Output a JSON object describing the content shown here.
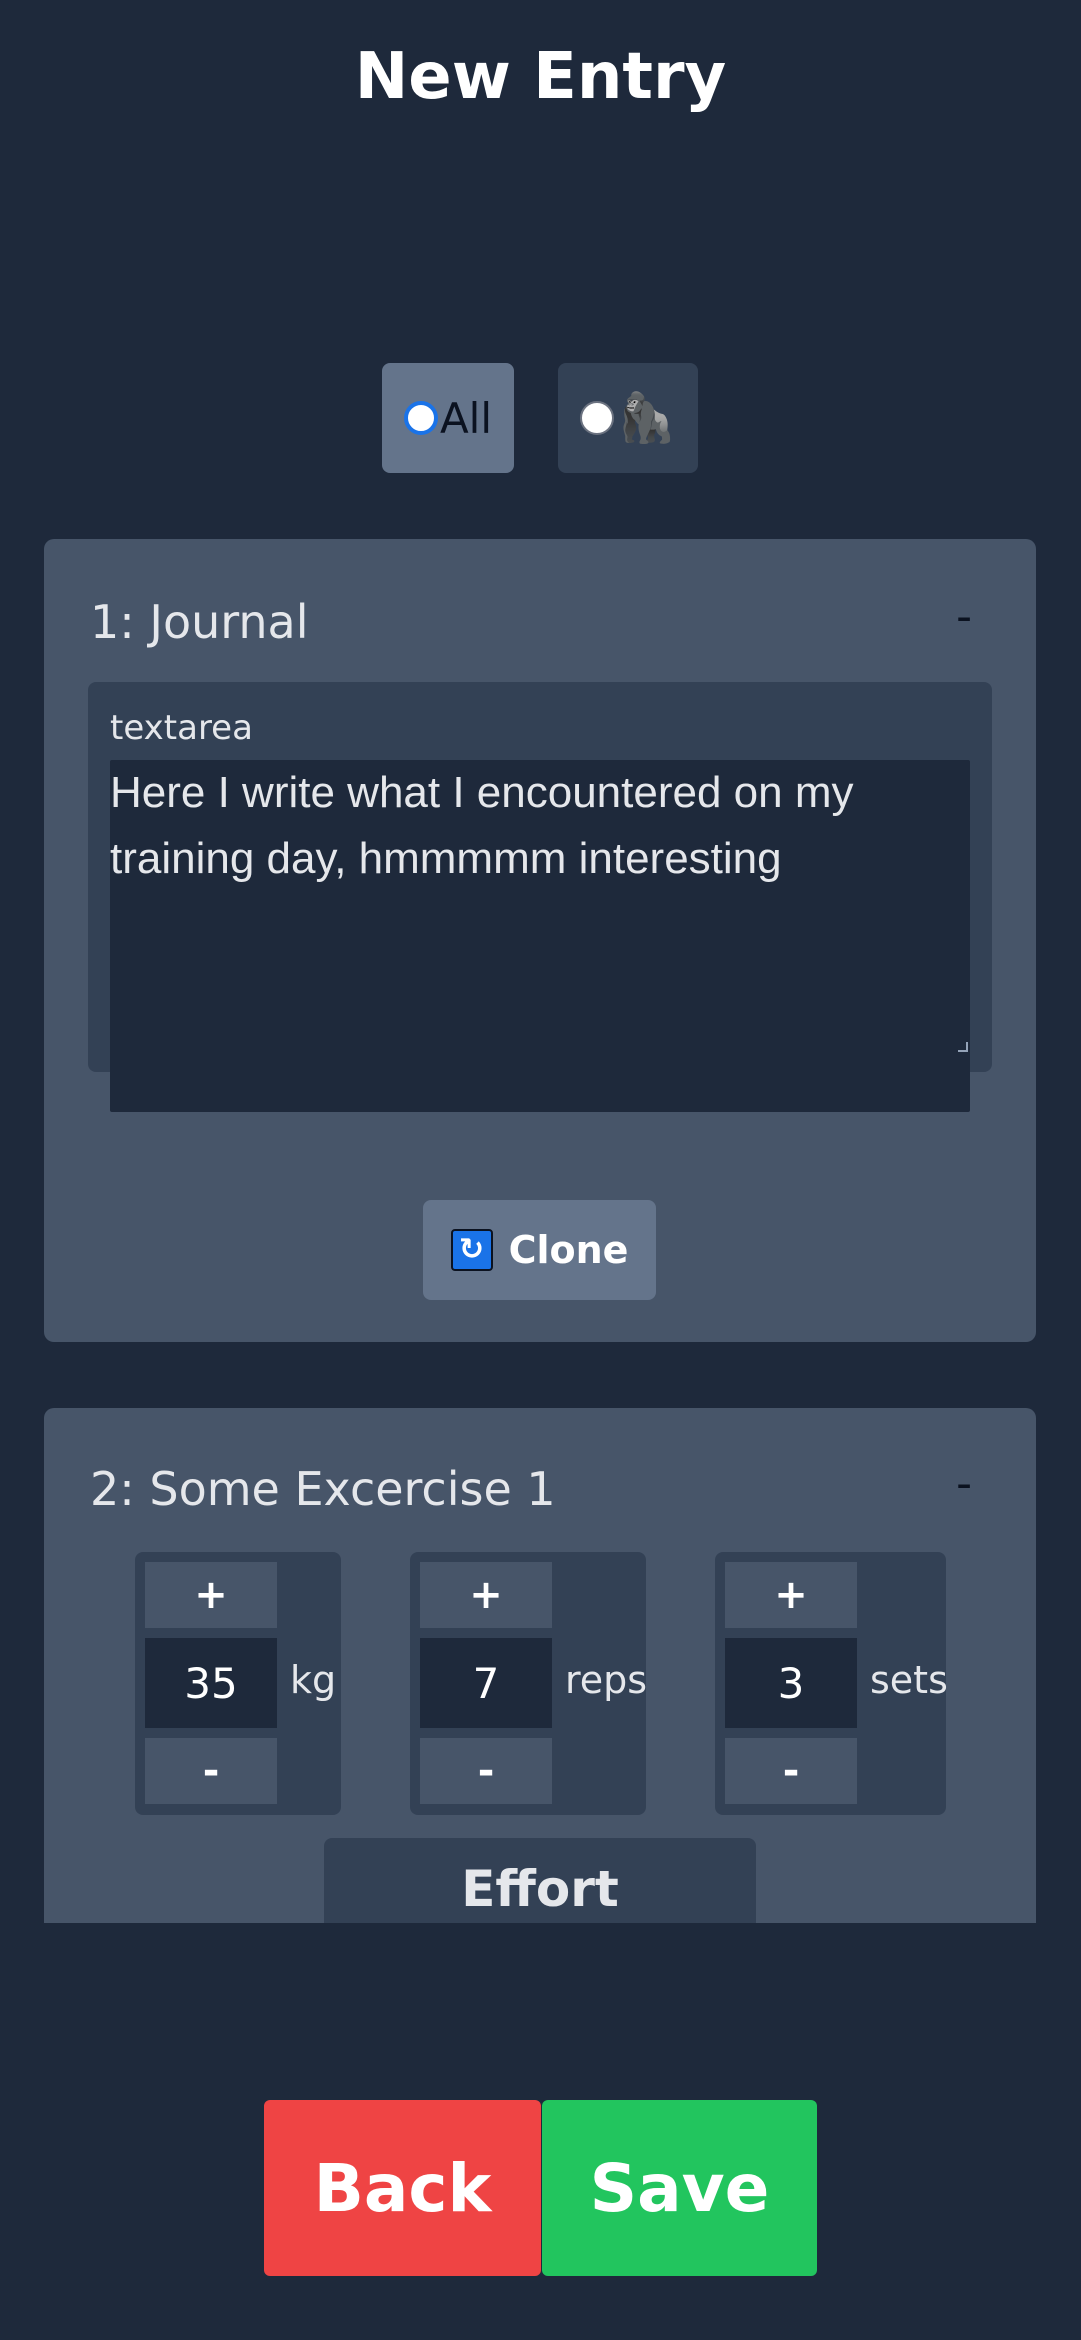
{
  "header": {
    "title": "New Entry"
  },
  "filters": [
    {
      "label": "All",
      "selected": true
    },
    {
      "icon": "gorilla-icon",
      "glyph": "🦍",
      "selected": false
    }
  ],
  "cards": {
    "journal": {
      "title": "1: Journal",
      "remove_label": "-",
      "textarea_label": "textarea",
      "textarea_value": "Here I write what I encountered on my training day, hmmmmm interesting",
      "clone_label": "Clone",
      "clone_icon": "repeat-icon"
    },
    "exercise": {
      "title": "2: Some Excercise 1",
      "remove_label": "-",
      "counters": {
        "kg": {
          "plus": "+",
          "value": "35",
          "unit": "kg",
          "minus": "-"
        },
        "reps": {
          "plus": "+",
          "value": "7",
          "unit": "reps",
          "minus": "-"
        },
        "sets": {
          "plus": "+",
          "value": "3",
          "unit": "sets",
          "minus": "-"
        }
      },
      "effort_label": "Effort"
    }
  },
  "footer": {
    "back_label": "Back",
    "save_label": "Save"
  },
  "colors": {
    "background": "#1e293b",
    "card": "#475569",
    "back": "#ef4444",
    "save": "#22c55e",
    "radio_accent": "#1a73e8"
  }
}
